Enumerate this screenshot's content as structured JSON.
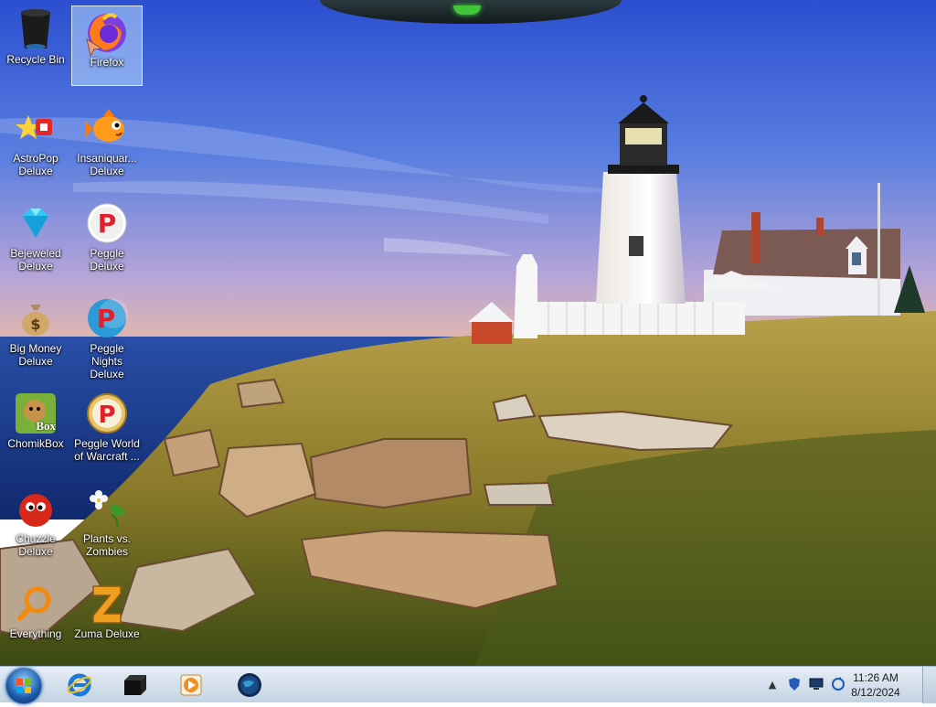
{
  "desktop": {
    "icons": [
      {
        "label": "Recycle Bin",
        "icon": "recycle-bin-icon"
      },
      {
        "label": "Firefox",
        "icon": "firefox-icon",
        "selected": true
      },
      {
        "label": "AstroPop\nDeluxe",
        "icon": "astropop-icon"
      },
      {
        "label": "Insaniquar...\nDeluxe",
        "icon": "insaniquarium-fish-icon"
      },
      {
        "label": "Bejeweled\nDeluxe",
        "icon": "bejeweled-gem-icon"
      },
      {
        "label": "Peggle Deluxe",
        "icon": "peggle-icon"
      },
      {
        "label": "Big Money\nDeluxe",
        "icon": "money-bag-icon"
      },
      {
        "label": "Peggle Nights\nDeluxe",
        "icon": "peggle-nights-icon"
      },
      {
        "label": "ChomikBox",
        "icon": "chomikbox-icon",
        "badge": "Box"
      },
      {
        "label": "Peggle World\nof Warcraft ...",
        "icon": "peggle-wow-icon"
      },
      {
        "label": "Chuzzle\nDeluxe",
        "icon": "chuzzle-icon"
      },
      {
        "label": "Plants vs.\nZombies",
        "icon": "plants-vs-zombies-icon"
      },
      {
        "label": "Everything",
        "icon": "everything-search-icon"
      },
      {
        "label": "Zuma Deluxe",
        "icon": "zuma-icon"
      }
    ]
  },
  "taskbar": {
    "start_icon": "windows-start-orb-icon",
    "pinned": [
      {
        "name": "internet-explorer-icon"
      },
      {
        "name": "terminal-app-icon"
      },
      {
        "name": "media-player-icon"
      },
      {
        "name": "globe-app-icon"
      }
    ],
    "tray": {
      "icons": [
        "tray-overflow-chevron-icon",
        "security-shield-icon",
        "network-monitor-icon",
        "sync-icon"
      ],
      "time": "11:26 AM",
      "date": "8/12/2024"
    }
  }
}
